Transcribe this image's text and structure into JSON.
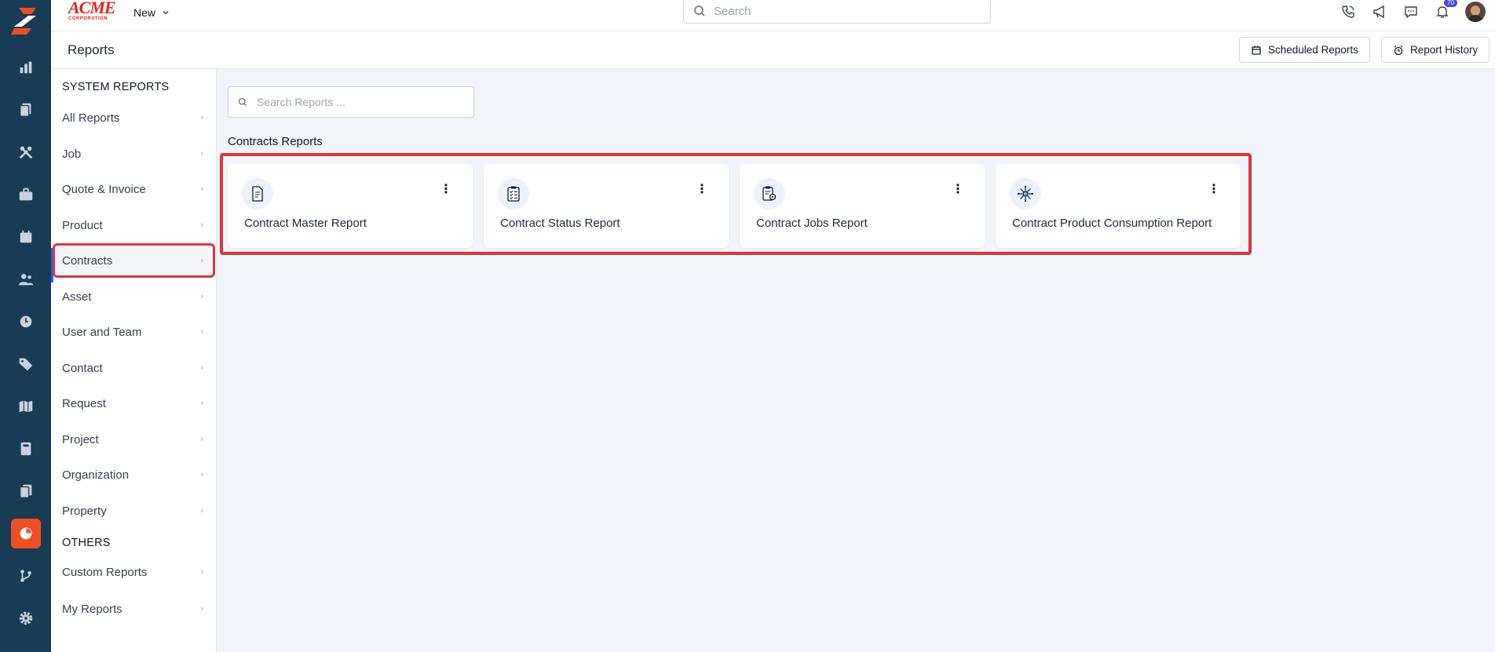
{
  "brand": {
    "name_line1": "ACME",
    "name_line2": "CORPORATION"
  },
  "topbar": {
    "new_label": "New",
    "search_placeholder": "Search",
    "notification_count": "70"
  },
  "header": {
    "title": "Reports",
    "scheduled_reports_label": "Scheduled Reports",
    "report_history_label": "Report History"
  },
  "rail_icons": [
    "dashboard-icon",
    "quotes-icon",
    "tools-icon",
    "briefcase-icon",
    "calendar-icon",
    "users-icon",
    "clock-icon",
    "tag-icon",
    "map-icon",
    "calculator-icon",
    "documents-icon",
    "reports-icon",
    "workflow-icon",
    "settings-icon"
  ],
  "sidebar": {
    "system_heading": "SYSTEM REPORTS",
    "system_items": [
      "All Reports",
      "Job",
      "Quote & Invoice",
      "Product",
      "Contracts",
      "Asset",
      "User and Team",
      "Contact",
      "Request",
      "Project",
      "Organization",
      "Property"
    ],
    "active_item": "Contracts",
    "others_heading": "OTHERS",
    "other_items": [
      "Custom Reports",
      "My Reports"
    ]
  },
  "main": {
    "search_placeholder": "Search Reports ...",
    "group_title": "Contracts Reports",
    "cards": [
      {
        "label": "Contract Master Report",
        "icon": "document-icon"
      },
      {
        "label": "Contract Status Report",
        "icon": "checklist-icon"
      },
      {
        "label": "Contract Jobs Report",
        "icon": "clipboard-gear-icon"
      },
      {
        "label": "Contract Product Consumption Report",
        "icon": "network-icon"
      }
    ]
  },
  "colors": {
    "rail": "#183b56",
    "accent": "#f04e23",
    "highlight": "#dc3545",
    "badge": "#4f46e5"
  }
}
